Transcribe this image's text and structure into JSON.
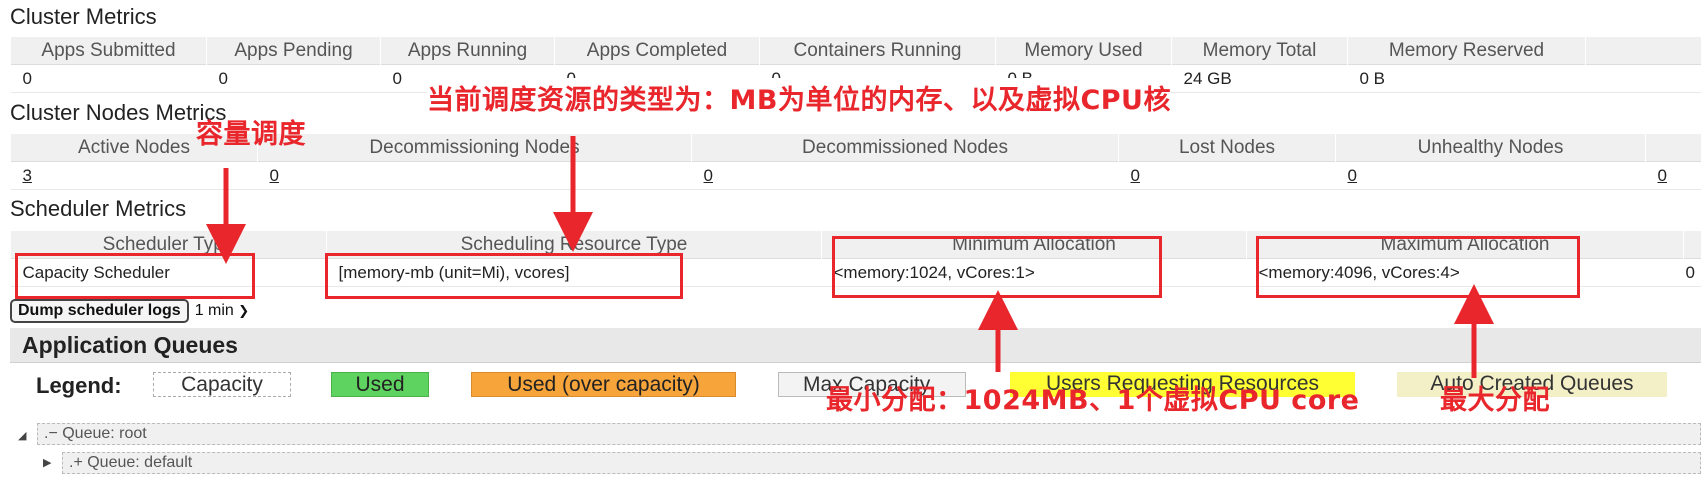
{
  "cluster_metrics": {
    "title": "Cluster Metrics",
    "headers": [
      "Apps Submitted",
      "Apps Pending",
      "Apps Running",
      "Apps Completed",
      "Containers Running",
      "Memory Used",
      "Memory Total",
      "Memory Reserved"
    ],
    "values": [
      "0",
      "0",
      "0",
      "0",
      "0",
      "0 B",
      "24 GB",
      "0 B"
    ]
  },
  "nodes_metrics": {
    "title": "Cluster Nodes Metrics",
    "headers": [
      "Active Nodes",
      "Decommissioning Nodes",
      "Decommissioned Nodes",
      "Lost Nodes",
      "Unhealthy Nodes",
      ""
    ],
    "values": [
      "3",
      "0",
      "0",
      "0",
      "0",
      "0"
    ]
  },
  "scheduler_metrics": {
    "title": "Scheduler Metrics",
    "headers": [
      "Scheduler Type",
      "Scheduling Resource Type",
      "Minimum Allocation",
      "Maximum Allocation",
      ""
    ],
    "values": [
      "Capacity Scheduler",
      "[memory-mb (unit=Mi), vcores]",
      "<memory:1024, vCores:1>",
      "<memory:4096, vCores:4>",
      "0"
    ]
  },
  "dump": {
    "button_label": "Dump scheduler logs",
    "interval": "1 min"
  },
  "queues": {
    "title": "Application Queues",
    "legend_label": "Legend:",
    "legend": [
      "Capacity",
      "Used",
      "Used (over capacity)",
      "Max Capacity",
      "Users Requesting Resources",
      "Auto Created Queues"
    ],
    "rows": [
      ".− Queue: root",
      ".+ Queue: default"
    ]
  },
  "annotations": {
    "resource_type_note": "当前调度资源的类型为：MB为单位的内存、以及虚拟CPU核",
    "capacity_note": "容量调度",
    "min_alloc_note": "最小分配：1024MB、1个虚拟CPU core",
    "max_alloc_note": "最大分配"
  },
  "colors": {
    "annotation_red": "#e8262b",
    "used_green": "#5fd35f",
    "over_capacity_orange": "#f7a43a",
    "users_requesting_yellow": "#ffff33",
    "auto_created_beige": "#f3f0c8"
  }
}
